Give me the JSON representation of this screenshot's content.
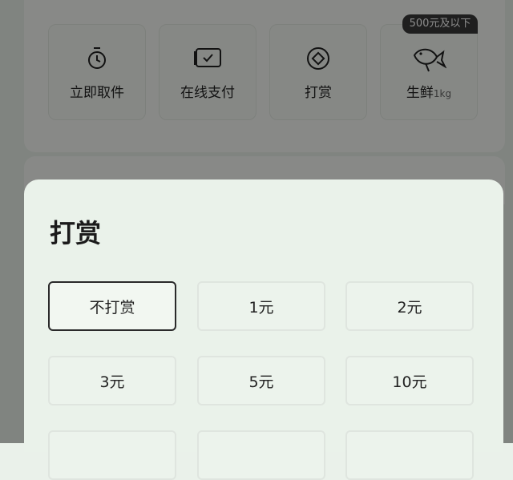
{
  "services": [
    {
      "label": "立即取件",
      "icon": "timer-icon"
    },
    {
      "label": "在线支付",
      "icon": "payment-icon"
    },
    {
      "label": "打赏",
      "icon": "reward-icon"
    },
    {
      "label": "生鲜",
      "sub": "1kg",
      "icon": "fish-icon"
    }
  ],
  "tag": "500元及以下",
  "sheet": {
    "title": "打赏",
    "options": [
      "不打赏",
      "1元",
      "2元",
      "3元",
      "5元",
      "10元"
    ],
    "selected_index": 0
  },
  "colors": {
    "overlay": "rgba(0,0,0,0.45)",
    "sheet_bg": "#eaf2ea",
    "selected_border": "#2a2a2a"
  }
}
